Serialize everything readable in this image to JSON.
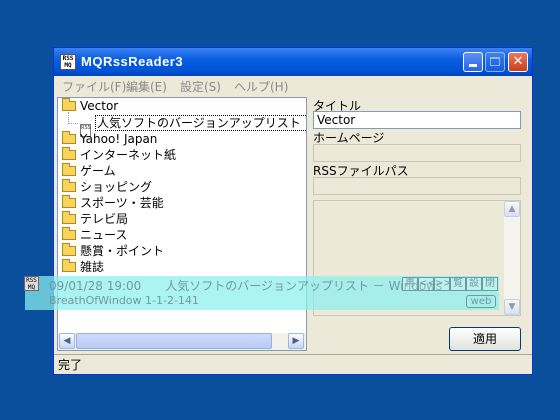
{
  "window": {
    "title": "MQRssReader3",
    "app_icon_text": "RSS MQ"
  },
  "menu": [
    "ファイル(F)",
    "編集(E)",
    "設定(S)",
    "ヘルプ(H)"
  ],
  "tree": {
    "items": [
      {
        "label": "Vector",
        "type": "folder"
      },
      {
        "label": "人気ソフトのバージョンアップリスト － Windo",
        "type": "feed"
      },
      {
        "label": "Yahoo! Japan",
        "type": "folder"
      },
      {
        "label": "インターネット紙",
        "type": "folder"
      },
      {
        "label": "ゲーム",
        "type": "folder"
      },
      {
        "label": "ショッピング",
        "type": "folder"
      },
      {
        "label": "スポーツ・芸能",
        "type": "folder"
      },
      {
        "label": "テレビ局",
        "type": "folder"
      },
      {
        "label": "ニュース",
        "type": "folder"
      },
      {
        "label": "懸賞・ポイント",
        "type": "folder"
      },
      {
        "label": "雑誌",
        "type": "folder"
      }
    ],
    "rss_icon_text": "RSS"
  },
  "form": {
    "title_label": "タイトル",
    "title_value": "Vector",
    "homepage_label": "ホームページ",
    "homepage_value": "",
    "rss_path_label": "RSSファイルパス",
    "rss_path_value": "",
    "apply_label": "適用"
  },
  "status": "完了",
  "ticker": {
    "icon_text": "RSS MQ",
    "line1": "09/01/28 19:00　　人気ソフトのバージョンアップリスト － Windows",
    "line2": "BreathOfWindow  1-1-2-141",
    "buttons": [
      "再",
      "<<",
      ">>",
      "覧",
      "設",
      "閉"
    ],
    "web_label": "web"
  }
}
